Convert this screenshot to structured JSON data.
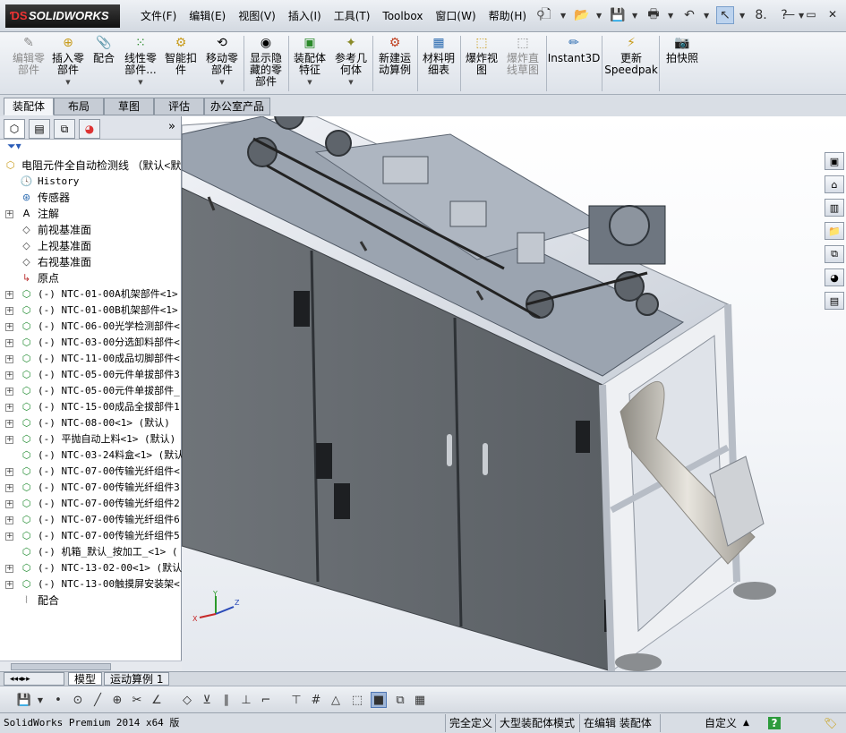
{
  "app": {
    "logo": "SOLIDWORKS"
  },
  "menu": {
    "items": [
      "文件(F)",
      "编辑(E)",
      "视图(V)",
      "插入(I)",
      "工具(T)",
      "Toolbox",
      "窗口(W)",
      "帮助(H)"
    ]
  },
  "command_manager": {
    "buttons": [
      {
        "label": "编辑零部件",
        "disabled": true
      },
      {
        "label": "插入零部件",
        "disabled": false
      },
      {
        "label": "配合",
        "disabled": false
      },
      {
        "label": "线性零部件...",
        "disabled": false
      },
      {
        "label": "智能扣件",
        "disabled": false
      },
      {
        "label": "移动零部件",
        "disabled": false
      },
      {
        "label": "显示隐藏的零部件",
        "disabled": false
      },
      {
        "label": "装配体特征",
        "disabled": false
      },
      {
        "label": "参考几何体",
        "disabled": false
      },
      {
        "label": "新建运动算例",
        "disabled": false
      },
      {
        "label": "材料明细表",
        "disabled": false
      },
      {
        "label": "爆炸视图",
        "disabled": false
      },
      {
        "label": "爆炸直线草图",
        "disabled": true
      },
      {
        "label": "Instant3D",
        "disabled": false
      },
      {
        "label": "更新Speedpak",
        "disabled": false
      },
      {
        "label": "拍快照",
        "disabled": false
      }
    ],
    "tabs": [
      "装配体",
      "布局",
      "草图",
      "评估",
      "办公室产品"
    ],
    "active_tab": "装配体"
  },
  "feature_tree": {
    "root": "电阻元件全自动检测线 （默认<默",
    "items": [
      {
        "label": "History",
        "icon": "history-icon",
        "mono": true,
        "expandable": false
      },
      {
        "label": "传感器",
        "icon": "sensor-icon",
        "mono": false,
        "expandable": false
      },
      {
        "label": "注解",
        "icon": "annotation-icon",
        "mono": false,
        "expandable": true
      },
      {
        "label": "前视基准面",
        "icon": "plane-icon",
        "mono": false,
        "expandable": false
      },
      {
        "label": "上视基准面",
        "icon": "plane-icon",
        "mono": false,
        "expandable": false
      },
      {
        "label": "右视基准面",
        "icon": "plane-icon",
        "mono": false,
        "expandable": false
      },
      {
        "label": "原点",
        "icon": "origin-icon",
        "mono": false,
        "expandable": false
      },
      {
        "label": "(-) NTC-01-00A机架部件<1>",
        "icon": "assembly-icon",
        "mono": true,
        "expandable": true
      },
      {
        "label": "(-) NTC-01-00B机架部件<1>",
        "icon": "assembly-icon",
        "mono": true,
        "expandable": true
      },
      {
        "label": "(-) NTC-06-00光学检测部件<",
        "icon": "assembly-icon",
        "mono": true,
        "expandable": true
      },
      {
        "label": "(-) NTC-03-00分选卸料部件<",
        "icon": "assembly-icon",
        "mono": true,
        "expandable": true
      },
      {
        "label": "(-) NTC-11-00成品切脚部件<",
        "icon": "assembly-icon",
        "mono": true,
        "expandable": true
      },
      {
        "label": "(-) NTC-05-00元件单拔部件3",
        "icon": "assembly-icon",
        "mono": true,
        "expandable": true
      },
      {
        "label": "(-) NTC-05-00元件单拔部件_",
        "icon": "assembly-icon",
        "mono": true,
        "expandable": true
      },
      {
        "label": "(-) NTC-15-00成品全拔部件1",
        "icon": "assembly-icon",
        "mono": true,
        "expandable": true
      },
      {
        "label": "(-) NTC-08-00<1> (默认)",
        "icon": "assembly-icon",
        "mono": true,
        "expandable": true
      },
      {
        "label": "(-) 平抛自动上料<1> (默认)",
        "icon": "assembly-icon",
        "mono": true,
        "expandable": true
      },
      {
        "label": "(-) NTC-03-24料盒<1> (默认",
        "icon": "assembly-icon",
        "mono": true,
        "expandable": false
      },
      {
        "label": "(-) NTC-07-00传输光纤组件<",
        "icon": "assembly-icon",
        "mono": true,
        "expandable": true
      },
      {
        "label": "(-) NTC-07-00传输光纤组件3",
        "icon": "assembly-icon",
        "mono": true,
        "expandable": true
      },
      {
        "label": "(-) NTC-07-00传输光纤组件2",
        "icon": "assembly-icon",
        "mono": true,
        "expandable": true
      },
      {
        "label": "(-) NTC-07-00传输光纤组件6",
        "icon": "assembly-icon",
        "mono": true,
        "expandable": true
      },
      {
        "label": "(-) NTC-07-00传输光纤组件5",
        "icon": "assembly-icon",
        "mono": true,
        "expandable": true
      },
      {
        "label": "(-) 机箱_默认_按加工_<1> (",
        "icon": "assembly-icon",
        "mono": true,
        "expandable": false
      },
      {
        "label": "(-) NTC-13-02-00<1> (默认)",
        "icon": "assembly-icon",
        "mono": true,
        "expandable": true
      },
      {
        "label": "(-) NTC-13-00触摸屏安装架<",
        "icon": "assembly-icon",
        "mono": true,
        "expandable": true
      },
      {
        "label": "配合",
        "icon": "mates-icon",
        "mono": false,
        "expandable": false
      }
    ]
  },
  "bottom_tabs": [
    "模型",
    "运动算例 1"
  ],
  "status": {
    "product": "SolidWorks Premium 2014 x64 版",
    "definition": "完全定义",
    "mode": "大型装配体模式",
    "editing": "在编辑 装配体",
    "units": "自定义",
    "help": "?"
  }
}
